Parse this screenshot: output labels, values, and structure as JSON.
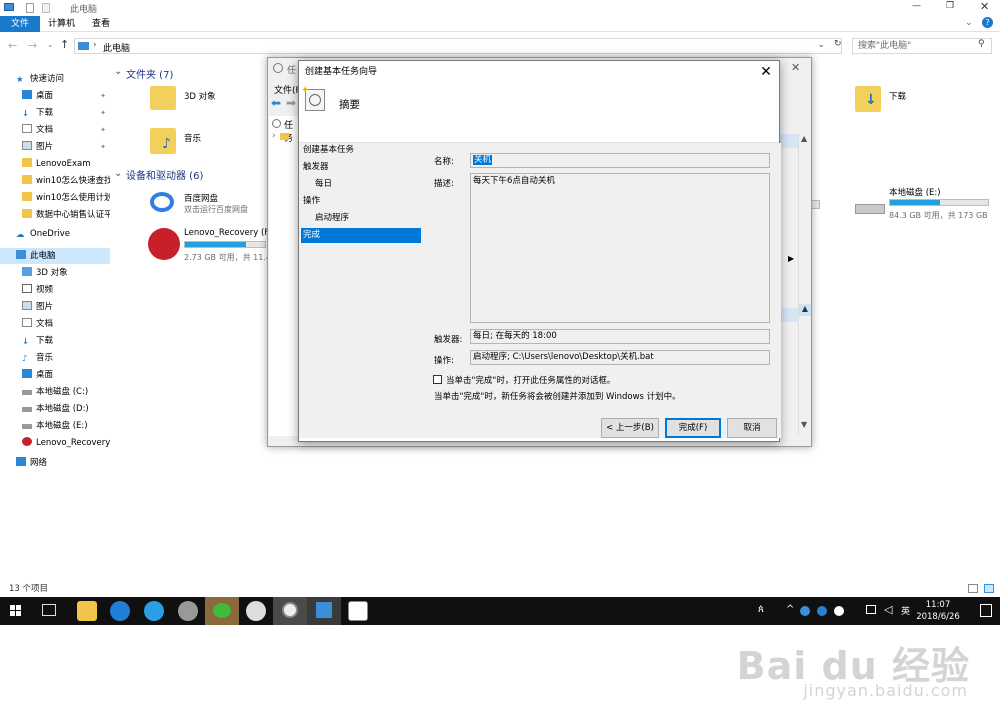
{
  "explorer": {
    "title": "此电脑",
    "ribbon_tabs": [
      "文件",
      "计算机",
      "查看"
    ],
    "address": "此电脑",
    "search_placeholder": "搜索\"此电脑\"",
    "status": "13 个项目"
  },
  "nav": {
    "quick_access": "快速访问",
    "items": [
      "桌面",
      "下载",
      "文档",
      "图片",
      "LenovoExam",
      "win10怎么快速查找",
      "win10怎么使用计划",
      "数据中心销售认证平"
    ],
    "onedrive": "OneDrive",
    "this_pc": "此电脑",
    "pc_items": [
      "3D 对象",
      "视频",
      "图片",
      "文档",
      "下载",
      "音乐",
      "桌面",
      "本地磁盘 (C:)",
      "本地磁盘 (D:)",
      "本地磁盘 (E:)",
      "Lenovo_Recovery"
    ],
    "network": "网络"
  },
  "content": {
    "folders_header": "文件夹 (7)",
    "folders": [
      "3D 对象",
      "音乐",
      "下载"
    ],
    "drives_header": "设备和驱动器 (6)",
    "baidu_title": "百度网盘",
    "baidu_sub": "双击运行百度网盘",
    "lenovo_title": "Lenovo_Recovery (F:)",
    "lenovo_sub": "2.73 GB 可用，共 11.4",
    "lenovo_fill": 0.76,
    "disk_e_title": "本地磁盘 (E:)",
    "disk_e_sub": "84.3 GB 可用，共 173 GB",
    "disk_e_fill": 0.51
  },
  "task_scheduler": {
    "title_partial": "任",
    "menu_partial": "文件(F",
    "tree_partial": "任务"
  },
  "wizard": {
    "title": "创建基本任务向导",
    "heading": "摘要",
    "steps": [
      "创建基本任务",
      "触发器",
      "每日",
      "操作",
      "启动程序",
      "完成"
    ],
    "name_label": "名称:",
    "name_value": "关机",
    "desc_label": "描述:",
    "desc_value": "每天下午6点自动关机",
    "trigger_label": "触发器:",
    "trigger_value": "每日; 在每天的 18:00",
    "action_label": "操作:",
    "action_value": "启动程序; C:\\Users\\lenovo\\Desktop\\关机.bat",
    "checkbox_label": "当单击\"完成\"时，打开此任务属性的对话框。",
    "note": "当单击\"完成\"时，新任务将会被创建并添加到 Windows 计划中。",
    "back_button": "< 上一步(B)",
    "finish_button": "完成(F)",
    "cancel_button": "取消"
  },
  "taskbar": {
    "ime": "英",
    "time": "11:07",
    "date": "2018/6/26"
  },
  "watermark": {
    "brand": "Bai du 经验",
    "url": "jingyan.baidu.com"
  }
}
